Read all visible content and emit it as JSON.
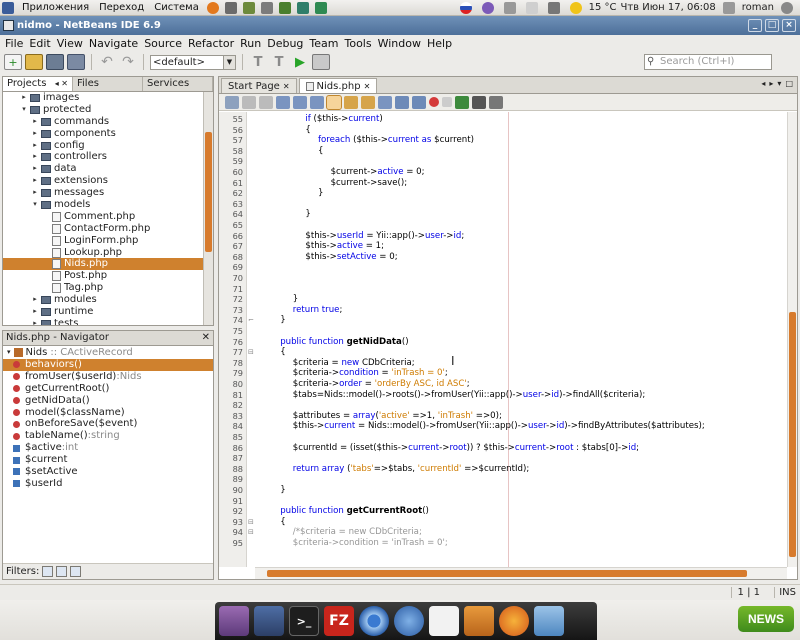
{
  "gnome_panel": {
    "menus": [
      "Приложения",
      "Переход",
      "Система"
    ],
    "temperature": "15 °C",
    "datetime": "Чтв Июн 17, 06:08",
    "user": "roman"
  },
  "window": {
    "title": "nidmo - NetBeans IDE 6.9"
  },
  "menubar": [
    "File",
    "Edit",
    "View",
    "Navigate",
    "Source",
    "Refactor",
    "Run",
    "Debug",
    "Team",
    "Tools",
    "Window",
    "Help"
  ],
  "toolbar": {
    "config": "<default>",
    "search_placeholder": "Search (Ctrl+I)"
  },
  "projects_panel": {
    "tabs": [
      "Projects",
      "Files",
      "Services"
    ],
    "tree": [
      {
        "label": "images",
        "type": "folder",
        "depth": 2,
        "toggle": "▸"
      },
      {
        "label": "protected",
        "type": "folder",
        "depth": 2,
        "toggle": "▾"
      },
      {
        "label": "commands",
        "type": "folder",
        "depth": 3,
        "toggle": "▸"
      },
      {
        "label": "components",
        "type": "folder",
        "depth": 3,
        "toggle": "▸"
      },
      {
        "label": "config",
        "type": "folder",
        "depth": 3,
        "toggle": "▸"
      },
      {
        "label": "controllers",
        "type": "folder",
        "depth": 3,
        "toggle": "▸"
      },
      {
        "label": "data",
        "type": "folder",
        "depth": 3,
        "toggle": "▸"
      },
      {
        "label": "extensions",
        "type": "folder",
        "depth": 3,
        "toggle": "▸"
      },
      {
        "label": "messages",
        "type": "folder",
        "depth": 3,
        "toggle": "▸"
      },
      {
        "label": "models",
        "type": "folder",
        "depth": 3,
        "toggle": "▾"
      },
      {
        "label": "Comment.php",
        "type": "file",
        "depth": 4,
        "toggle": ""
      },
      {
        "label": "ContactForm.php",
        "type": "file",
        "depth": 4,
        "toggle": ""
      },
      {
        "label": "LoginForm.php",
        "type": "file",
        "depth": 4,
        "toggle": ""
      },
      {
        "label": "Lookup.php",
        "type": "file",
        "depth": 4,
        "toggle": ""
      },
      {
        "label": "Nids.php",
        "type": "file",
        "depth": 4,
        "toggle": "",
        "selected": true
      },
      {
        "label": "Post.php",
        "type": "file",
        "depth": 4,
        "toggle": ""
      },
      {
        "label": "Tag.php",
        "type": "file",
        "depth": 4,
        "toggle": ""
      },
      {
        "label": "modules",
        "type": "folder",
        "depth": 3,
        "toggle": "▸"
      },
      {
        "label": "runtime",
        "type": "folder",
        "depth": 3,
        "toggle": "▸"
      },
      {
        "label": "tests",
        "type": "folder",
        "depth": 3,
        "toggle": "▸"
      }
    ]
  },
  "navigator": {
    "title": "Nids.php - Navigator",
    "class_name": "Nids",
    "class_extends": ":: CActiveRecord",
    "items": [
      {
        "kind": "method",
        "name": "behaviors()",
        "type": "",
        "selected": true
      },
      {
        "kind": "method",
        "name": "fromUser($userId)",
        "type": ":Nids"
      },
      {
        "kind": "method",
        "name": "getCurrentRoot()",
        "type": ""
      },
      {
        "kind": "method",
        "name": "getNidData()",
        "type": ""
      },
      {
        "kind": "method",
        "name": "model($className)",
        "type": ""
      },
      {
        "kind": "method",
        "name": "onBeforeSave($event)",
        "type": ""
      },
      {
        "kind": "method",
        "name": "tableName()",
        "type": ":string"
      },
      {
        "kind": "field",
        "name": "$active",
        "type": ":int"
      },
      {
        "kind": "field",
        "name": "$current",
        "type": ""
      },
      {
        "kind": "field",
        "name": "$setActive",
        "type": ""
      },
      {
        "kind": "field",
        "name": "$userId",
        "type": ""
      }
    ],
    "filters_label": "Filters:"
  },
  "editor": {
    "tabs": [
      {
        "label": "Start Page",
        "active": false
      },
      {
        "label": "Nids.php",
        "active": true
      }
    ],
    "lines": [
      {
        "n": "55",
        "indent": 8,
        "code": [
          [
            "kw",
            "if"
          ],
          [
            "pn",
            " ("
          ],
          [
            "var",
            "$this"
          ],
          [
            "pn",
            "->"
          ],
          [
            "kw",
            "current"
          ],
          [
            "pn",
            ")"
          ]
        ]
      },
      {
        "n": "56",
        "indent": 8,
        "code": [
          [
            "pn",
            "{"
          ]
        ]
      },
      {
        "n": "57",
        "indent": 10,
        "code": [
          [
            "kw",
            "foreach"
          ],
          [
            "pn",
            " ("
          ],
          [
            "var",
            "$this"
          ],
          [
            "pn",
            "->"
          ],
          [
            "kw",
            "current"
          ],
          [
            "kw",
            " as "
          ],
          [
            "var",
            "$current"
          ],
          [
            "pn",
            ")"
          ]
        ]
      },
      {
        "n": "58",
        "indent": 10,
        "code": [
          [
            "pn",
            "{"
          ]
        ]
      },
      {
        "n": "59",
        "indent": 12,
        "code": []
      },
      {
        "n": "60",
        "indent": 12,
        "code": [
          [
            "var",
            "$current"
          ],
          [
            "pn",
            "->"
          ],
          [
            "kw",
            "active"
          ],
          [
            "pn",
            " = 0;"
          ]
        ]
      },
      {
        "n": "61",
        "indent": 12,
        "code": [
          [
            "var",
            "$current"
          ],
          [
            "pn",
            "->"
          ],
          [
            "pn",
            "save();"
          ]
        ]
      },
      {
        "n": "62",
        "indent": 10,
        "code": [
          [
            "pn",
            "}"
          ]
        ]
      },
      {
        "n": "63",
        "indent": 10,
        "code": []
      },
      {
        "n": "64",
        "indent": 8,
        "code": [
          [
            "pn",
            "}"
          ]
        ]
      },
      {
        "n": "65",
        "indent": 8,
        "code": []
      },
      {
        "n": "66",
        "indent": 8,
        "code": [
          [
            "var",
            "$this"
          ],
          [
            "pn",
            "->"
          ],
          [
            "kw",
            "userId"
          ],
          [
            "pn",
            " = Yii::"
          ],
          [
            "pn",
            "app"
          ],
          [
            "pn",
            "()->"
          ],
          [
            "kw",
            "user"
          ],
          [
            "pn",
            "->"
          ],
          [
            "kw",
            "id"
          ],
          [
            "pn",
            ";"
          ]
        ]
      },
      {
        "n": "67",
        "indent": 8,
        "code": [
          [
            "var",
            "$this"
          ],
          [
            "pn",
            "->"
          ],
          [
            "kw",
            "active"
          ],
          [
            "pn",
            " = 1;"
          ]
        ]
      },
      {
        "n": "68",
        "indent": 8,
        "code": [
          [
            "var",
            "$this"
          ],
          [
            "pn",
            "->"
          ],
          [
            "kw",
            "setActive"
          ],
          [
            "pn",
            " = 0;"
          ]
        ]
      },
      {
        "n": "69",
        "indent": 8,
        "code": []
      },
      {
        "n": "70",
        "indent": 8,
        "code": []
      },
      {
        "n": "71",
        "indent": 8,
        "code": []
      },
      {
        "n": "72",
        "indent": 6,
        "code": [
          [
            "pn",
            "}"
          ]
        ]
      },
      {
        "n": "73",
        "indent": 6,
        "code": [
          [
            "kw",
            "return true"
          ],
          [
            "pn",
            ";"
          ]
        ]
      },
      {
        "n": "74",
        "indent": 4,
        "code": [
          [
            "pn",
            "}"
          ]
        ],
        "marker": "⌐"
      },
      {
        "n": "75",
        "indent": 4,
        "code": []
      },
      {
        "n": "76",
        "indent": 4,
        "code": [
          [
            "kw",
            "public function "
          ],
          [
            "fnm",
            "getNidData"
          ],
          [
            "pn",
            "()"
          ]
        ]
      },
      {
        "n": "77",
        "indent": 4,
        "code": [
          [
            "pn",
            "{"
          ]
        ],
        "marker": "⊟"
      },
      {
        "n": "78",
        "indent": 6,
        "code": [
          [
            "var",
            "$criteria"
          ],
          [
            "pn",
            " = "
          ],
          [
            "kw",
            "new "
          ],
          [
            "pn",
            "CDbCriteria;"
          ]
        ]
      },
      {
        "n": "79",
        "indent": 6,
        "code": [
          [
            "var",
            "$criteria"
          ],
          [
            "pn",
            "->"
          ],
          [
            "kw",
            "condition"
          ],
          [
            "pn",
            " = "
          ],
          [
            "str",
            "'inTrash = 0'"
          ],
          [
            "pn",
            ";"
          ]
        ]
      },
      {
        "n": "80",
        "indent": 6,
        "code": [
          [
            "var",
            "$criteria"
          ],
          [
            "pn",
            "->"
          ],
          [
            "kw",
            "order"
          ],
          [
            "pn",
            " = "
          ],
          [
            "str",
            "'orderBy ASC, id ASC'"
          ],
          [
            "pn",
            ";"
          ]
        ]
      },
      {
        "n": "81",
        "indent": 6,
        "code": [
          [
            "var",
            "$tabs"
          ],
          [
            "pn",
            "=Nids::"
          ],
          [
            "pn",
            "model"
          ],
          [
            "pn",
            "()->roots()->fromUser(Yii::"
          ],
          [
            "pn",
            "app"
          ],
          [
            "pn",
            "()->"
          ],
          [
            "kw",
            "user"
          ],
          [
            "pn",
            "->"
          ],
          [
            "kw",
            "id"
          ],
          [
            "pn",
            ")->findAll("
          ],
          [
            "var",
            "$criteria"
          ],
          [
            "pn",
            ");"
          ]
        ]
      },
      {
        "n": "82",
        "indent": 6,
        "code": []
      },
      {
        "n": "83",
        "indent": 6,
        "code": [
          [
            "var",
            "$attributes"
          ],
          [
            "pn",
            " = "
          ],
          [
            "kw",
            "array"
          ],
          [
            "pn",
            "("
          ],
          [
            "str",
            "'active'"
          ],
          [
            "pn",
            " =>1, "
          ],
          [
            "str",
            "'inTrash'"
          ],
          [
            "pn",
            " =>0);"
          ]
        ]
      },
      {
        "n": "84",
        "indent": 6,
        "code": [
          [
            "var",
            "$this"
          ],
          [
            "pn",
            "->"
          ],
          [
            "kw",
            "current"
          ],
          [
            "pn",
            " = Nids::"
          ],
          [
            "pn",
            "model"
          ],
          [
            "pn",
            "()->fromUser(Yii::"
          ],
          [
            "pn",
            "app"
          ],
          [
            "pn",
            "()->"
          ],
          [
            "kw",
            "user"
          ],
          [
            "pn",
            "->"
          ],
          [
            "kw",
            "id"
          ],
          [
            "pn",
            ")->findByAttributes("
          ],
          [
            "var",
            "$attributes"
          ],
          [
            "pn",
            ");"
          ]
        ]
      },
      {
        "n": "85",
        "indent": 6,
        "code": []
      },
      {
        "n": "86",
        "indent": 6,
        "code": [
          [
            "var",
            "$currentId"
          ],
          [
            "pn",
            " = (isset("
          ],
          [
            "var",
            "$this"
          ],
          [
            "pn",
            "->"
          ],
          [
            "kw",
            "current"
          ],
          [
            "pn",
            "->"
          ],
          [
            "kw",
            "root"
          ],
          [
            "pn",
            ")) ? "
          ],
          [
            "var",
            "$this"
          ],
          [
            "pn",
            "->"
          ],
          [
            "kw",
            "current"
          ],
          [
            "pn",
            "->"
          ],
          [
            "kw",
            "root"
          ],
          [
            "pn",
            " : "
          ],
          [
            "var",
            "$tabs"
          ],
          [
            "pn",
            "[0]->"
          ],
          [
            "kw",
            "id"
          ],
          [
            "pn",
            ";"
          ]
        ]
      },
      {
        "n": "87",
        "indent": 6,
        "code": []
      },
      {
        "n": "88",
        "indent": 6,
        "code": [
          [
            "kw",
            "return array"
          ],
          [
            "pn",
            " ("
          ],
          [
            "str",
            "'tabs'"
          ],
          [
            "pn",
            "=>"
          ],
          [
            "var",
            "$tabs"
          ],
          [
            "pn",
            ", "
          ],
          [
            "str",
            "'currentId'"
          ],
          [
            "pn",
            " =>"
          ],
          [
            "var",
            "$currentId"
          ],
          [
            "pn",
            ");"
          ]
        ]
      },
      {
        "n": "89",
        "indent": 6,
        "code": []
      },
      {
        "n": "90",
        "indent": 4,
        "code": [
          [
            "pn",
            "}"
          ]
        ]
      },
      {
        "n": "91",
        "indent": 4,
        "code": []
      },
      {
        "n": "92",
        "indent": 4,
        "code": [
          [
            "kw",
            "public function "
          ],
          [
            "fnm",
            "getCurrentRoot"
          ],
          [
            "pn",
            "()"
          ]
        ]
      },
      {
        "n": "93",
        "indent": 4,
        "code": [
          [
            "pn",
            "{"
          ]
        ],
        "marker": "⊟"
      },
      {
        "n": "94",
        "indent": 6,
        "code": [
          [
            "cm",
            "/*$criteria = new CDbCriteria;"
          ]
        ],
        "marker": "⊟"
      },
      {
        "n": "95",
        "indent": 6,
        "code": [
          [
            "cm",
            "$criteria->condition = 'inTrash = 0';"
          ]
        ]
      }
    ]
  },
  "statusbar": {
    "position": "1 | 1",
    "mode": "INS"
  },
  "dock": {
    "filezilla_label": "FZ",
    "news_label": "NEWS"
  }
}
